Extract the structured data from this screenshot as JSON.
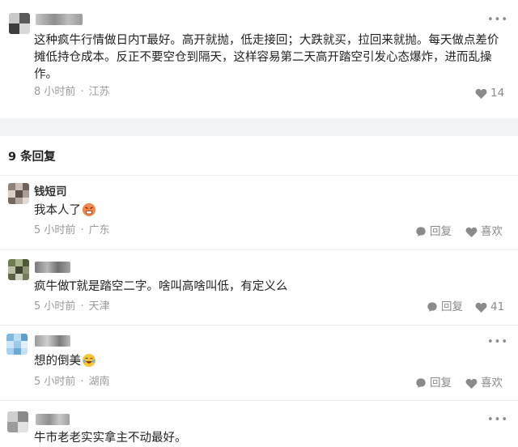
{
  "main": {
    "text": "这种疯牛行情做日内T最好。高开就抛，低走接回；大跌就买，拉回来就抛。每天做点差价摊低持仓成本。反正不要空仓到隔天，这样容易第二天高开踏空引发心态爆炸，进而乱操作。",
    "time": "8 小时前",
    "location": "江苏",
    "likes": "14"
  },
  "replies_header": "9 条回复",
  "replies": [
    {
      "name": "钱短司",
      "text": "我本人了",
      "time": "5 小时前",
      "location": "广东",
      "reply_label": "回复",
      "like_label": "喜欢"
    },
    {
      "name": "",
      "text": "疯牛做T就是踏空二字。啥叫高啥叫低，有定义么",
      "time": "5 小时前",
      "location": "天津",
      "reply_label": "回复",
      "like_count": "41"
    },
    {
      "name": "",
      "text": "想的倒美",
      "time": "5 小时前",
      "location": "湖南",
      "reply_label": "回复",
      "like_label": "喜欢"
    },
    {
      "name": "",
      "text": "牛市老老实实拿主不动最好。"
    }
  ],
  "colors": {
    "meta_gray": "#9a9a9a",
    "band_gray": "#f2f3f5"
  },
  "icons": [
    "more-dots-icon",
    "heart-icon",
    "reply-bubble-icon",
    "angry-emoji-icon",
    "laughing-emoji-icon"
  ]
}
